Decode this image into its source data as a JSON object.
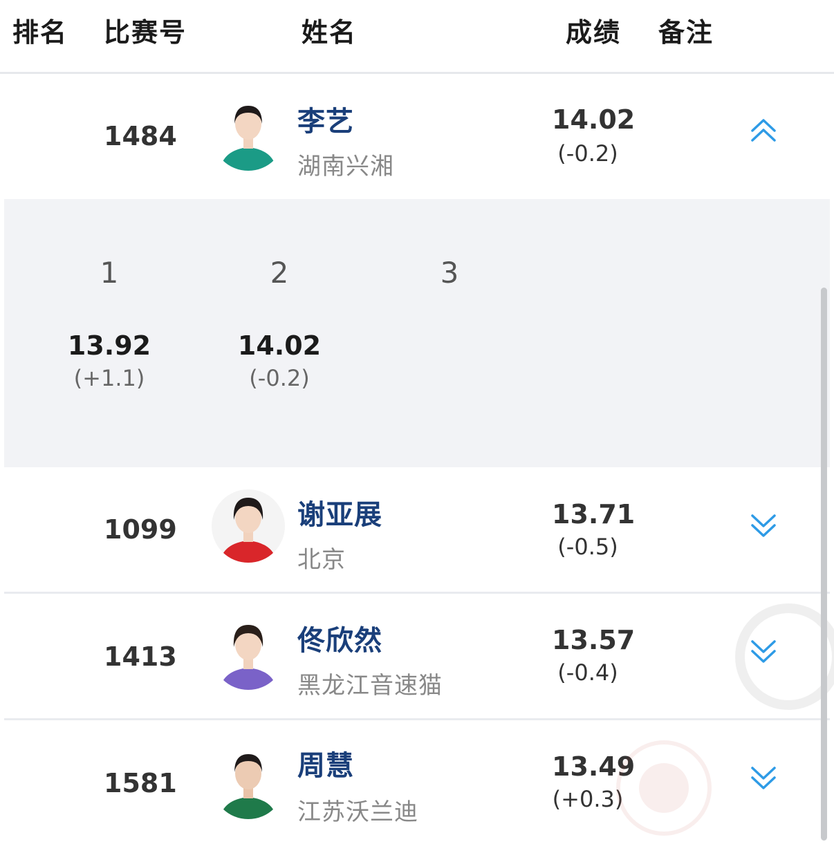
{
  "header": {
    "rank": "排名",
    "bib": "比赛号",
    "name": "姓名",
    "result": "成绩",
    "note": "备注"
  },
  "rows": [
    {
      "bib": "1484",
      "name": "李艺",
      "team": "湖南兴湘",
      "result": "14.02",
      "wind": "(-0.2)",
      "expanded": true,
      "jersey_color": "#1b9b86"
    },
    {
      "bib": "1099",
      "name": "谢亚展",
      "team": "北京",
      "result": "13.71",
      "wind": "(-0.5)",
      "expanded": false,
      "jersey_color": "#d9262a"
    },
    {
      "bib": "1413",
      "name": "佟欣然",
      "team": "黑龙江音速猫",
      "result": "13.57",
      "wind": "(-0.4)",
      "expanded": false,
      "jersey_color": "#7a62c8"
    },
    {
      "bib": "1581",
      "name": "周慧",
      "team": "江苏沃兰迪",
      "result": "13.49",
      "wind": "(+0.3)",
      "expanded": false,
      "jersey_color": "#1f7a4a"
    }
  ],
  "attempts": {
    "labels": [
      "1",
      "2",
      "3"
    ],
    "values": [
      "13.92",
      "14.02"
    ],
    "winds": [
      "(+1.1)",
      "(-0.2)"
    ]
  },
  "colors": {
    "accent": "#2e9be6",
    "name": "#1a3f7a",
    "detail_bg": "#f2f3f6"
  },
  "icons": {
    "expanded": "chevron-double-up-icon",
    "collapsed": "chevron-double-down-icon"
  }
}
